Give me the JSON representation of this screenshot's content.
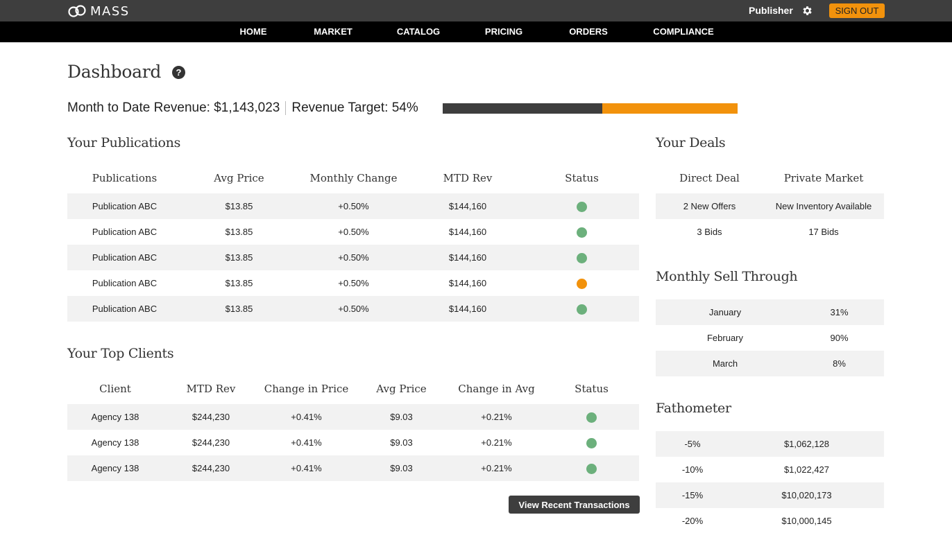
{
  "header": {
    "logo_text": "MASS",
    "role": "Publisher",
    "settings_icon": "gear-icon",
    "signout_label": "SIGN OUT",
    "accent_color": "#f2920c"
  },
  "nav": [
    "HOME",
    "MARKET",
    "CATALOG",
    "PRICING",
    "ORDERS",
    "COMPLIANCE"
  ],
  "page": {
    "title": "Dashboard",
    "help_icon": "?"
  },
  "revenue": {
    "mtd_text": "Month to Date Revenue: $1,143,023",
    "target_text": "Revenue Target: 54%",
    "target_percent": 54
  },
  "publications": {
    "title": "Your Publications",
    "columns": [
      "Publications",
      "Avg Price",
      "Monthly Change",
      "MTD Rev",
      "Status"
    ],
    "rows": [
      [
        "Publication ABC",
        "$13.85",
        "+0.50%",
        "$144,160",
        "green"
      ],
      [
        "Publication ABC",
        "$13.85",
        "+0.50%",
        "$144,160",
        "green"
      ],
      [
        "Publication ABC",
        "$13.85",
        "+0.50%",
        "$144,160",
        "green"
      ],
      [
        "Publication ABC",
        "$13.85",
        "+0.50%",
        "$144,160",
        "orange"
      ],
      [
        "Publication ABC",
        "$13.85",
        "+0.50%",
        "$144,160",
        "green"
      ]
    ]
  },
  "clients": {
    "title": "Your Top Clients",
    "columns": [
      "Client",
      "MTD Rev",
      "Change in Price",
      "Avg Price",
      "Change in Avg",
      "Status"
    ],
    "rows": [
      [
        "Agency 138",
        "$244,230",
        "+0.41%",
        "$9.03",
        "+0.21%",
        "green"
      ],
      [
        "Agency 138",
        "$244,230",
        "+0.41%",
        "$9.03",
        "+0.21%",
        "green"
      ],
      [
        "Agency 138",
        "$244,230",
        "+0.41%",
        "$9.03",
        "+0.21%",
        "green"
      ]
    ],
    "view_button": "View Recent Transactions"
  },
  "deals": {
    "title": "Your Deals",
    "columns": [
      "Direct Deal",
      "Private Market"
    ],
    "rows": [
      [
        "2 New Offers",
        "New Inventory Available"
      ],
      [
        "3 Bids",
        "17 Bids"
      ]
    ]
  },
  "sell_through": {
    "title": "Monthly Sell Through",
    "rows": [
      [
        "January",
        "31%"
      ],
      [
        "February",
        "90%"
      ],
      [
        "March",
        "8%"
      ]
    ]
  },
  "fathometer": {
    "title": "Fathometer",
    "rows": [
      [
        "-5%",
        "$1,062,128"
      ],
      [
        "-10%",
        "$1,022,427"
      ],
      [
        "-15%",
        "$10,020,173"
      ],
      [
        "-20%",
        "$10,000,145"
      ]
    ]
  },
  "status_colors": {
    "green": "#6cb07c",
    "orange": "#f2920c"
  }
}
